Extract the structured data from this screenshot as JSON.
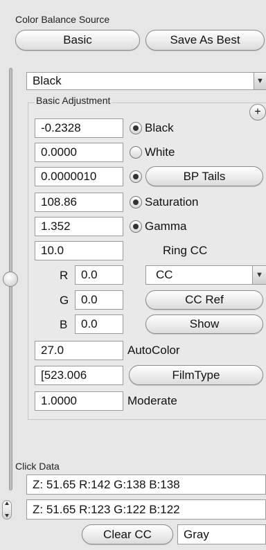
{
  "header": {
    "source_label": "Color Balance Source",
    "basic_label": "Basic",
    "save_best_label": "Save As Best"
  },
  "mode_select": {
    "selected": "Black",
    "arrow": "▼"
  },
  "group": {
    "title": "Basic Adjustment",
    "plus_label": "+"
  },
  "rows": {
    "black_value": "-0.2328",
    "black_label": "Black",
    "white_value": "0.0000",
    "white_label": "White",
    "bp_value": "0.0000010",
    "bp_label": "BP Tails",
    "sat_value": "108.86",
    "sat_label": "Saturation",
    "gamma_value": "1.352",
    "gamma_label": "Gamma",
    "ring_value": "10.0",
    "ring_label": "Ring CC"
  },
  "rgb": {
    "r_label": "R",
    "r_value": "0.0",
    "g_label": "G",
    "g_value": "0.0",
    "b_label": "B",
    "b_value": "0.0"
  },
  "cc_select": {
    "selected": "CC",
    "arrow": "▼"
  },
  "cc_ref_label": "CC Ref",
  "show_label": "Show",
  "autocolor": {
    "value": "27.0",
    "label": "AutoColor"
  },
  "filmtype": {
    "value": "[523.006",
    "label": "FilmType"
  },
  "moderate": {
    "value": "1.0000",
    "label": "Moderate"
  },
  "click_data": {
    "title": "Click Data",
    "line1": "Z:  51.65  R:142 G:138 B:138",
    "line2": "Z:  51.65 R:123 G:122 B:122"
  },
  "bottom": {
    "clear_cc_label": "Clear CC",
    "gray_value": "Gray"
  },
  "radio_states": {
    "black": true,
    "white": false,
    "bp": true,
    "sat": true,
    "gamma": true
  }
}
